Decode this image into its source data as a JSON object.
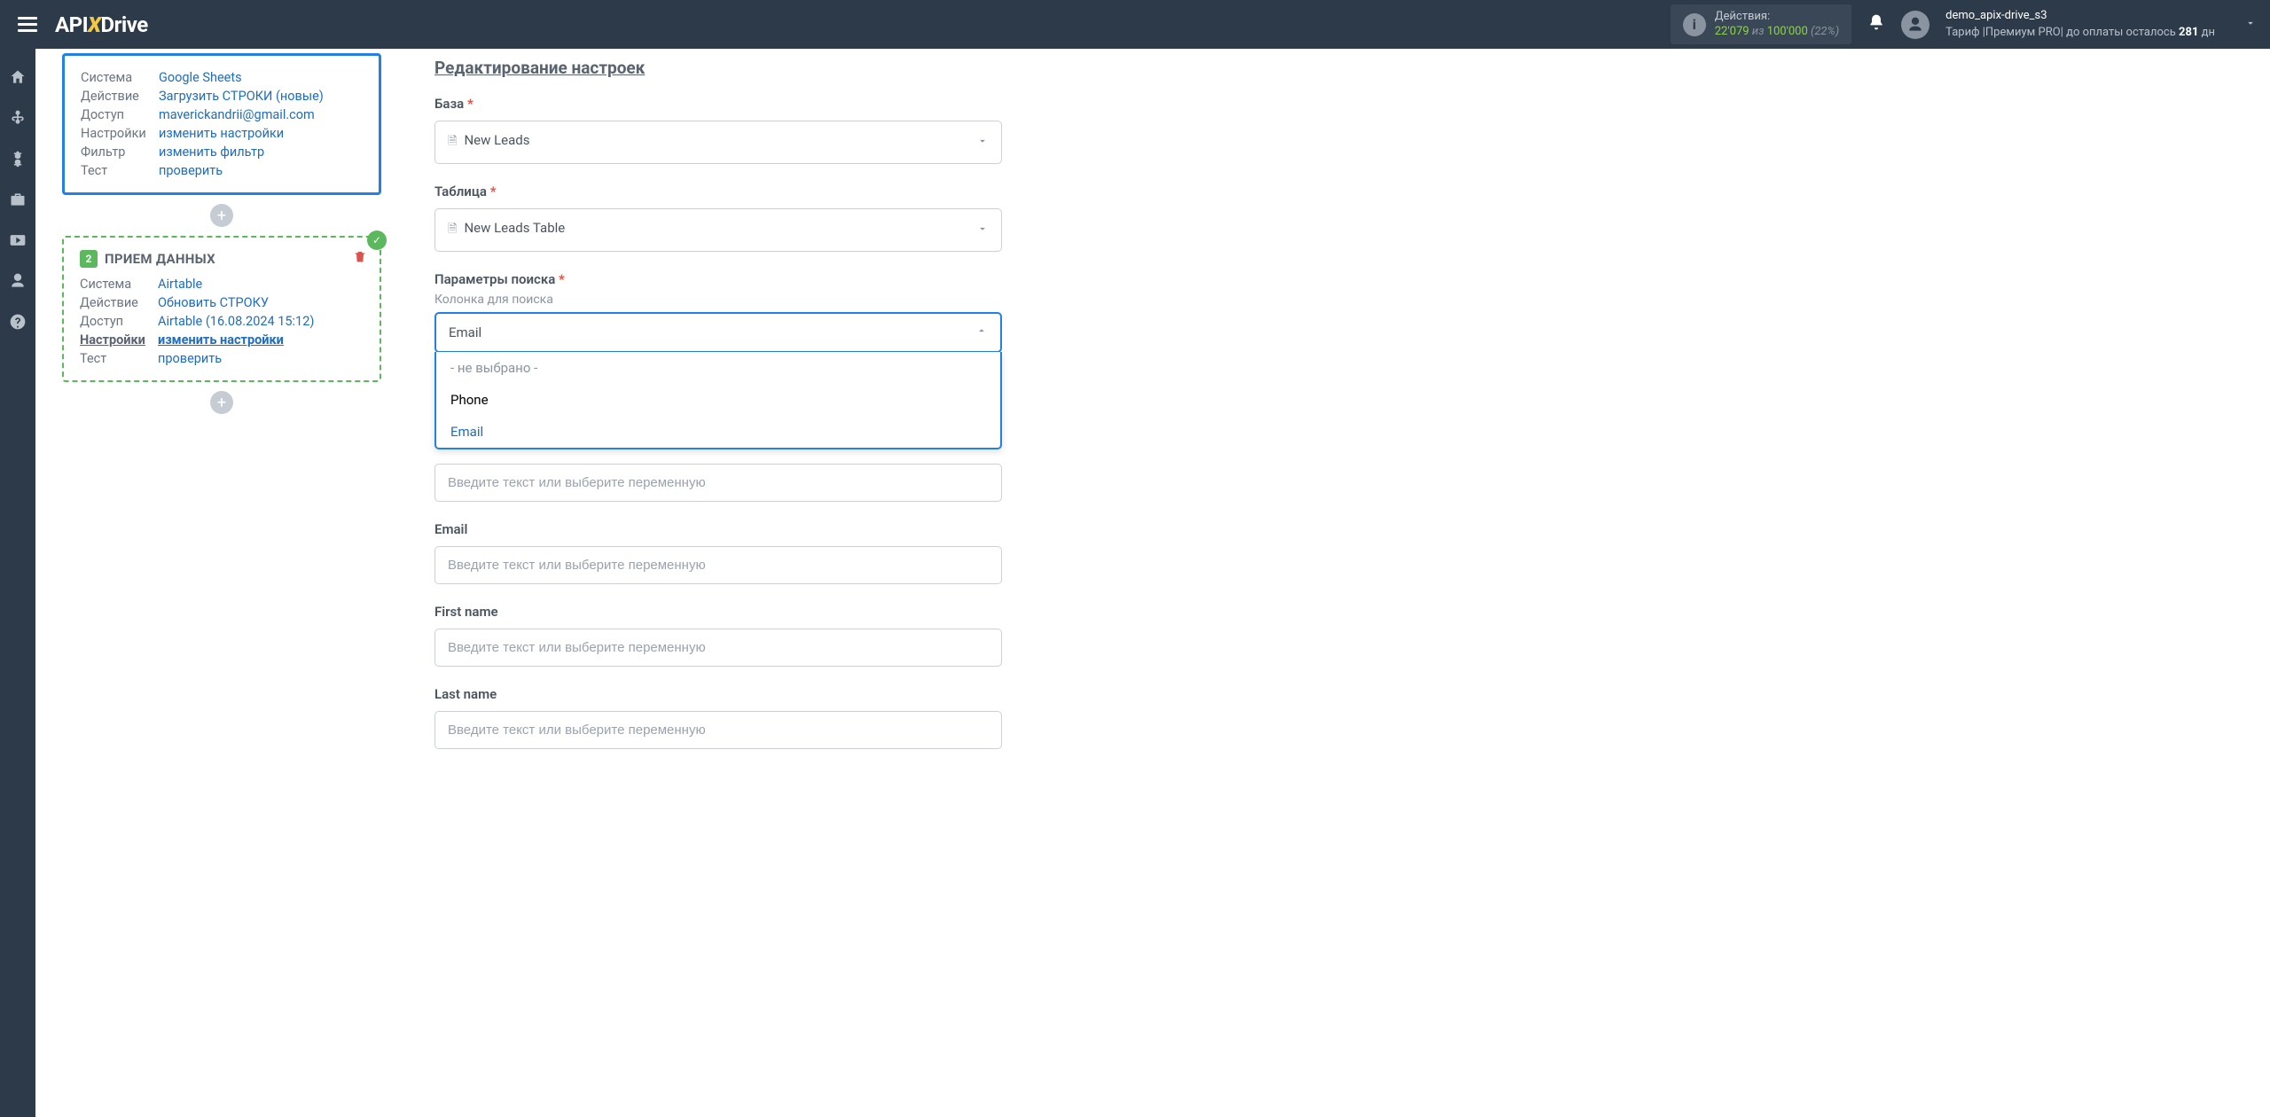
{
  "topbar": {
    "logo_pre": "API",
    "logo_x": "X",
    "logo_post": "Drive",
    "actions_label": "Действия:",
    "actions_used": "22'079",
    "actions_of": "из",
    "actions_total": "100'000",
    "actions_pct": "(22%)",
    "user_name": "demo_apix-drive_s3",
    "tariff_prefix": "Тариф |",
    "tariff_name": "Премиум PRO",
    "tariff_suffix": "|  до оплаты осталось ",
    "tariff_days": "281",
    "tariff_days_unit": " дн"
  },
  "sidebar_card_source": {
    "rows": [
      {
        "label": "Система",
        "value": "Google Sheets"
      },
      {
        "label": "Действие",
        "value": "Загрузить СТРОКИ (новые)"
      },
      {
        "label": "Доступ",
        "value": "maverickandrii@gmail.com"
      },
      {
        "label": "Настройки",
        "value": "изменить настройки"
      },
      {
        "label": "Фильтр",
        "value": "изменить фильтр"
      },
      {
        "label": "Тест",
        "value": "проверить"
      }
    ]
  },
  "sidebar_card_dest": {
    "step_num": "2",
    "step_title": "ПРИЕМ ДАННЫХ",
    "rows": [
      {
        "label": "Система",
        "value": "Airtable",
        "active": false
      },
      {
        "label": "Действие",
        "value": "Обновить СТРОКУ",
        "active": false
      },
      {
        "label": "Доступ",
        "value": "Airtable (16.08.2024 15:12)",
        "active": false
      },
      {
        "label": "Настройки",
        "value": "изменить настройки",
        "active": true
      },
      {
        "label": "Тест",
        "value": "проверить",
        "active": false
      }
    ]
  },
  "form": {
    "title": "Редактирование настроек",
    "base_label": "База",
    "base_value": "New Leads",
    "table_label": "Таблица",
    "table_value": "New Leads Table",
    "search_label": "Параметры поиска",
    "search_col_label": "Колонка для поиска",
    "search_col_value": "Email",
    "search_options": [
      {
        "text": "- не выбрано -",
        "kind": "muted"
      },
      {
        "text": "Phone",
        "kind": "normal"
      },
      {
        "text": "Email",
        "kind": "selected"
      }
    ],
    "var_placeholder": "Введите текст или выберите переменную",
    "field_email": "Email",
    "field_first": "First name",
    "field_last": "Last name"
  }
}
